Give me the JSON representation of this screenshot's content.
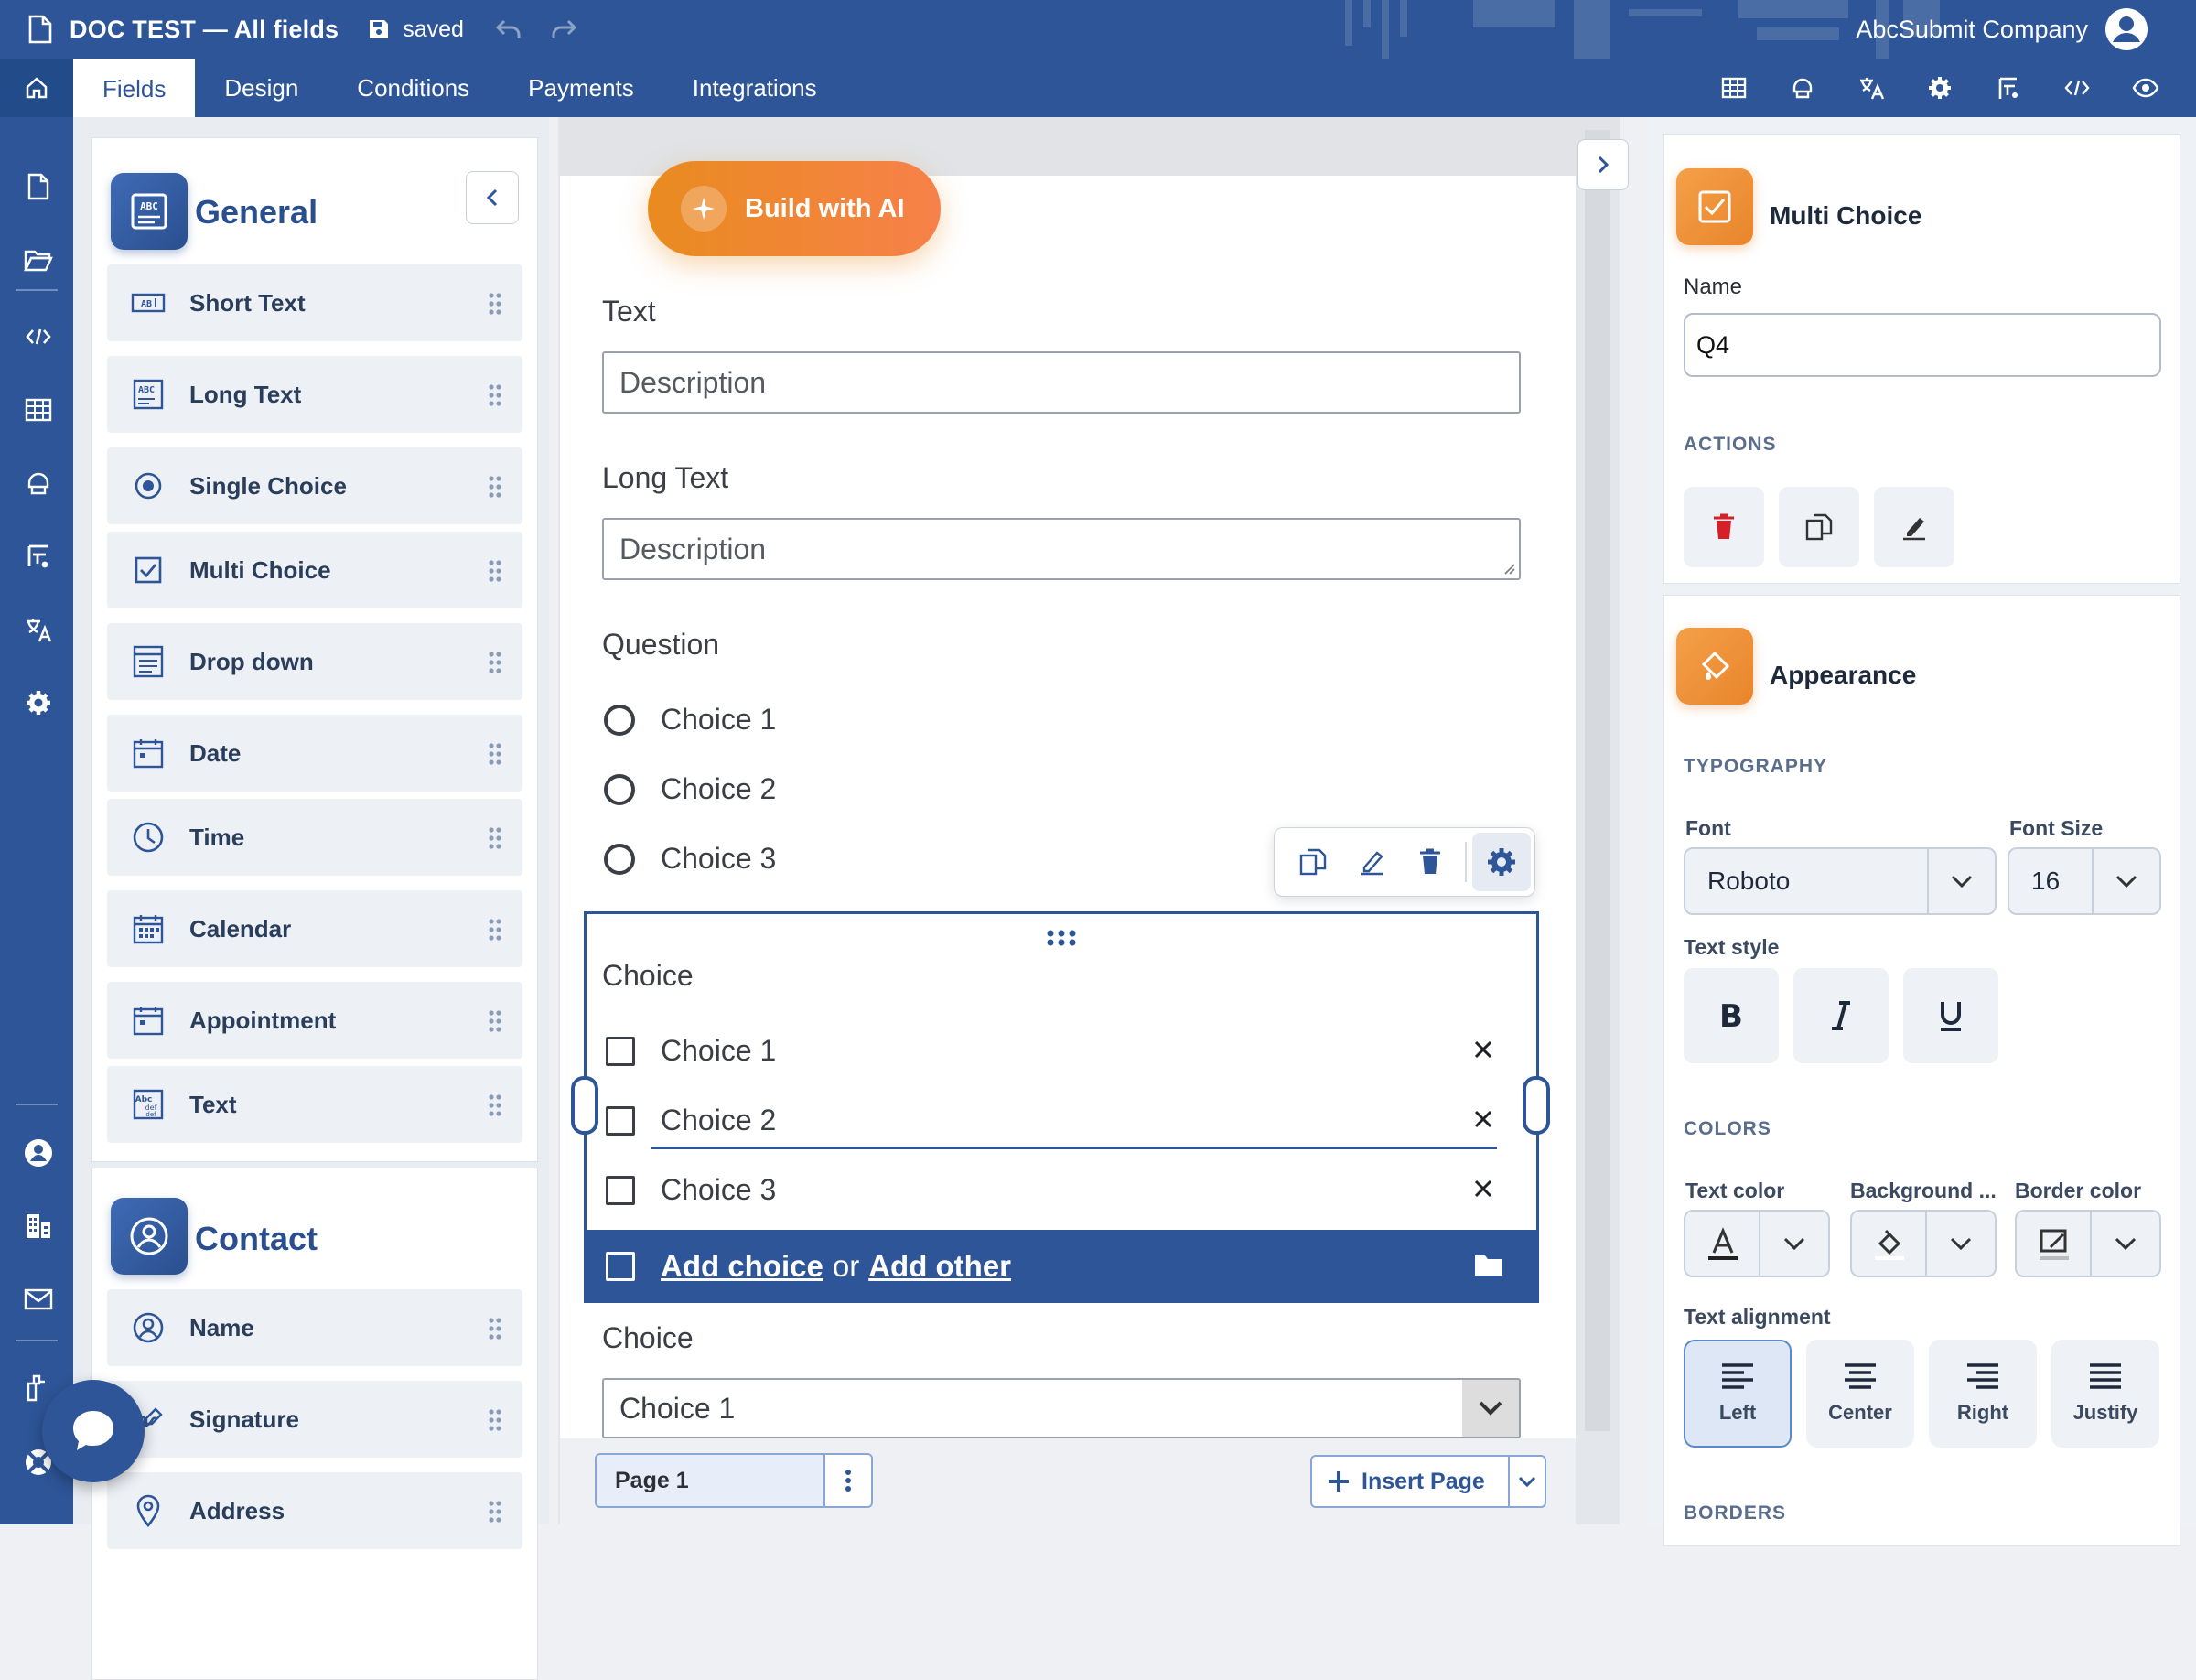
{
  "header": {
    "doc_title": "DOC TEST — All fields",
    "save_status": "saved",
    "company": "AbcSubmit Company"
  },
  "nav": {
    "tabs": [
      {
        "label": "Fields",
        "active": true
      },
      {
        "label": "Design"
      },
      {
        "label": "Conditions"
      },
      {
        "label": "Payments"
      },
      {
        "label": "Integrations"
      }
    ],
    "right_icons": [
      "table-icon",
      "theme-icon",
      "translate-icon",
      "settings-icon",
      "flow-icon",
      "embed-code-icon",
      "preview-icon"
    ]
  },
  "rail": {
    "icons": [
      "new-document-icon",
      "open-folder-icon",
      "code-icon",
      "table-icon",
      "theme-icon",
      "flow-icon",
      "translate-icon",
      "settings-icon",
      "user-icon",
      "organization-icon",
      "mail-icon",
      "plugin-icon",
      "support-icon"
    ]
  },
  "palette": {
    "general": {
      "title": "General",
      "items": [
        {
          "label": "Short Text",
          "icon": "short-text-icon"
        },
        {
          "label": "Long Text",
          "icon": "long-text-icon"
        },
        {
          "label": "Single Choice",
          "icon": "radio-icon"
        },
        {
          "label": "Multi Choice",
          "icon": "checkbox-icon"
        },
        {
          "label": "Drop down",
          "icon": "dropdown-icon"
        },
        {
          "label": "Date",
          "icon": "date-icon"
        },
        {
          "label": "Time",
          "icon": "clock-icon"
        },
        {
          "label": "Calendar",
          "icon": "calendar-icon"
        },
        {
          "label": "Appointment",
          "icon": "appointment-icon"
        },
        {
          "label": "Text",
          "icon": "text-block-icon"
        }
      ]
    },
    "contact": {
      "title": "Contact",
      "items": [
        {
          "label": "Name",
          "icon": "person-icon"
        },
        {
          "label": "Signature",
          "icon": "signature-icon"
        },
        {
          "label": "Address",
          "icon": "location-icon"
        }
      ]
    }
  },
  "canvas": {
    "ai_button": "Build with AI",
    "fields": {
      "text_label": "Text",
      "text_placeholder": "Description",
      "longtext_label": "Long Text",
      "longtext_placeholder": "Description",
      "question_label": "Question",
      "question_choices": [
        "Choice 1",
        "Choice 2",
        "Choice 3"
      ],
      "choice_label": "Choice",
      "choice_options": [
        "Choice 1",
        "Choice 2",
        "Choice 3"
      ],
      "add_choice": "Add choice",
      "or": "or",
      "add_other": "Add other",
      "dropdown_label": "Choice",
      "dropdown_value": "Choice 1"
    },
    "page_label": "Page 1",
    "insert_page": "Insert Page"
  },
  "props": {
    "element_title": "Multi Choice",
    "name_label": "Name",
    "name_value": "Q4",
    "actions_head": "ACTIONS",
    "appearance_title": "Appearance",
    "typography_head": "TYPOGRAPHY",
    "font_label": "Font",
    "font_value": "Roboto",
    "font_size_label": "Font Size",
    "font_size_value": "16",
    "text_style_label": "Text style",
    "colors_head": "COLORS",
    "text_color_label": "Text color",
    "background_label": "Background ...",
    "border_color_label": "Border color",
    "text_align_label": "Text alignment",
    "align_options": [
      "Left",
      "Center",
      "Right",
      "Justify"
    ],
    "align_selected": "Left",
    "borders_head": "BORDERS"
  },
  "colors": {
    "brand": "#2d5597",
    "accent_orange": "#e98b1f",
    "delete_red": "#d61f26"
  }
}
